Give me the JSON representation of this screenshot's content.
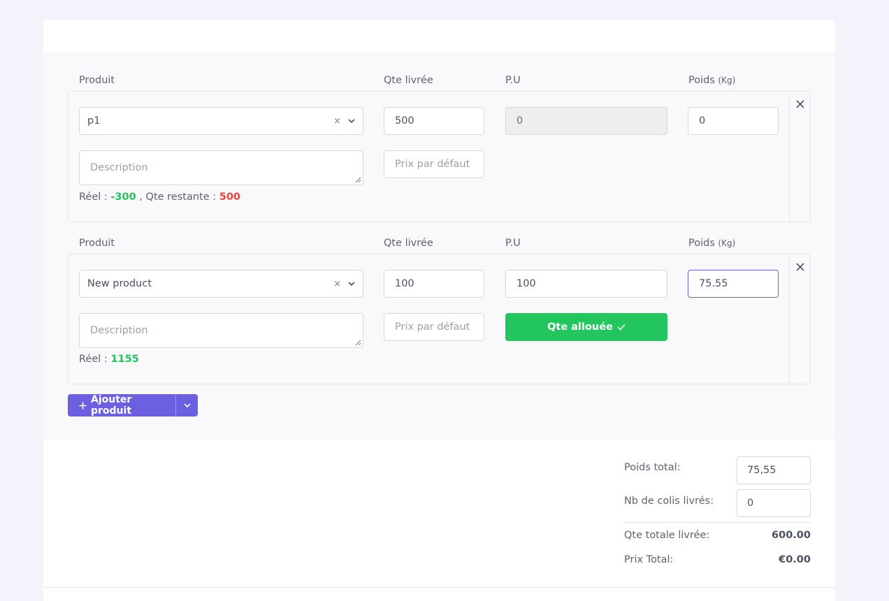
{
  "rows": [
    {
      "labels": {
        "product": "Produit",
        "qty": "Qte livrée",
        "unit_price": "P.U",
        "weight": "Poids",
        "weight_unit": "(Kg)"
      },
      "product_value": "p1",
      "product_clear": "×",
      "qty_value": "500",
      "unit_price_value": "0",
      "weight_value": "0",
      "description_placeholder": "Description",
      "price_select_placeholder": "Prix par défaut",
      "reel_label": "Réel : ",
      "reel_value": "-300",
      "remaining_label": " , Qte restante : ",
      "remaining_value": "500"
    },
    {
      "labels": {
        "product": "Produit",
        "qty": "Qte livrée",
        "unit_price": "P.U",
        "weight": "Poids",
        "weight_unit": "(Kg)"
      },
      "product_value": "New product",
      "product_clear": "×",
      "qty_value": "100",
      "unit_price_value": "100",
      "weight_value": "75.55",
      "description_placeholder": "Description",
      "price_select_placeholder": "Prix par défaut",
      "allocated_button": "Qte allouée",
      "reel_label": "Réel : ",
      "reel_value": "1155"
    }
  ],
  "add_product_button": "Ajouter produit",
  "summary": {
    "total_weight_label": "Poids total:",
    "total_weight_value": "75,55",
    "packages_label": "Nb de colis livrés:",
    "packages_value": "0",
    "total_qty_label": "Qte totale livrée:",
    "total_qty_value": "600.00",
    "total_price_label": "Prix Total:",
    "total_price_value": "€0.00"
  },
  "colors": {
    "accent": "#6c5fe0",
    "success": "#22c55e",
    "danger": "#ef4444"
  },
  "icons": [
    "close-icon",
    "chevron-down-icon",
    "check-icon",
    "plus-icon",
    "resize-grip-icon"
  ]
}
